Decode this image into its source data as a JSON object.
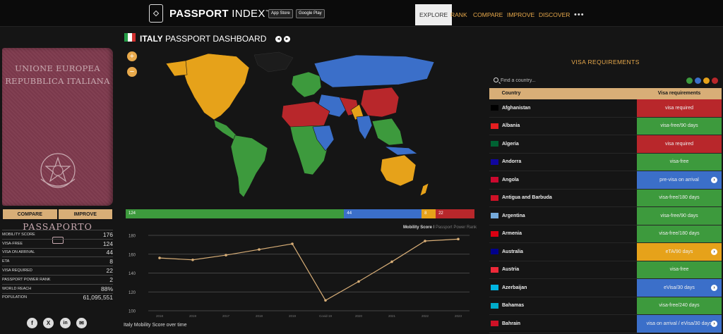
{
  "header": {
    "brand_bold": "PASSPORT",
    "brand_rest": " INDEX",
    "trademark": "™",
    "app_store": "App Store",
    "google_play": "Google Play",
    "nav": [
      "EXPLORE",
      "RANK",
      "COMPARE",
      "IMPROVE",
      "DISCOVER"
    ],
    "more": "•••"
  },
  "passport": {
    "line1": "UNIONE EUROPEA",
    "line2": "REPUBBLICA ITALIANA",
    "bottom": "PASSAPORTO"
  },
  "actions": {
    "compare": "COMPARE",
    "improve": "IMPROVE"
  },
  "stats": [
    {
      "label": "MOBILITY SCORE",
      "value": "176"
    },
    {
      "label": "VISA-FREE",
      "value": "124"
    },
    {
      "label": "VISA ON ARRIVAL",
      "value": "44"
    },
    {
      "label": "ETA",
      "value": "8"
    },
    {
      "label": "VISA REQUIRED",
      "value": "22"
    },
    {
      "label": "PASSPORT POWER RANK",
      "value": "2"
    },
    {
      "label": "WORLD REACH",
      "value": "88%"
    },
    {
      "label": "POPULATION",
      "value": "61,095,551"
    }
  ],
  "social": [
    "f",
    "X",
    "in",
    "✉"
  ],
  "dashboard": {
    "title_bold": "ITALY",
    "title_rest": " PASSPORT DASHBOARD",
    "zoom_in": "+",
    "zoom_out": "−",
    "prev": "◂",
    "next": "▸"
  },
  "breakdown": [
    {
      "label": "124",
      "value": 124,
      "color": "#3d9a3d"
    },
    {
      "label": "44",
      "value": 44,
      "color": "#3b6fc9"
    },
    {
      "label": "8",
      "value": 8,
      "color": "#e6a21a"
    },
    {
      "label": "22",
      "value": 22,
      "color": "#b8272b"
    }
  ],
  "colors": {
    "visa_free": "#3d9a3d",
    "visa_on_arrival": "#3b6fc9",
    "eta": "#e6a21a",
    "visa_required": "#b8272b",
    "accent": "#d8ae77",
    "nav_accent": "#e8a94b"
  },
  "chart_legend": {
    "active": "Mobility Score",
    "separator": " I ",
    "inactive": "Passport Power Rank"
  },
  "chart_data": {
    "type": "line",
    "title": "Italy Mobility Score over time",
    "x": [
      "2018",
      "2019",
      "2017",
      "2018",
      "2019",
      "Covid-19",
      "2020",
      "2021",
      "2022",
      "2023"
    ],
    "values": [
      156,
      154,
      159,
      165,
      171,
      111,
      131,
      152,
      174,
      176
    ],
    "yticks": [
      100,
      120,
      140,
      160,
      180
    ],
    "ylim": [
      100,
      180
    ],
    "series_color": "#d8ae77",
    "grid": true
  },
  "visa": {
    "title": "VISA REQUIREMENTS",
    "search_placeholder": "Find a country...",
    "col_country": "Country",
    "col_req": "Visa requirements",
    "filter_dots": [
      "#3d9a3d",
      "#3b6fc9",
      "#e6a21a",
      "#b8272b"
    ],
    "rows": [
      {
        "country": "Afghanistan",
        "req": "visa required",
        "kind": "visa_required",
        "info": false
      },
      {
        "country": "Albania",
        "req": "visa-free/90 days",
        "kind": "visa_free",
        "info": false
      },
      {
        "country": "Algeria",
        "req": "visa required",
        "kind": "visa_required",
        "info": false
      },
      {
        "country": "Andorra",
        "req": "visa-free",
        "kind": "visa_free",
        "info": false
      },
      {
        "country": "Angola",
        "req": "pre-visa on arrival",
        "kind": "visa_on_arrival",
        "info": true
      },
      {
        "country": "Antigua and Barbuda",
        "req": "visa-free/180 days",
        "kind": "visa_free",
        "info": false
      },
      {
        "country": "Argentina",
        "req": "visa-free/90 days",
        "kind": "visa_free",
        "info": false
      },
      {
        "country": "Armenia",
        "req": "visa-free/180 days",
        "kind": "visa_free",
        "info": false
      },
      {
        "country": "Australia",
        "req": "eTA/90 days",
        "kind": "eta",
        "info": true
      },
      {
        "country": "Austria",
        "req": "visa-free",
        "kind": "visa_free",
        "info": false
      },
      {
        "country": "Azerbaijan",
        "req": "eVisa/30 days",
        "kind": "visa_on_arrival",
        "info": true
      },
      {
        "country": "Bahamas",
        "req": "visa-free/240 days",
        "kind": "visa_free",
        "info": false
      },
      {
        "country": "Bahrain",
        "req": "visa on arrival / eVisa/30 days",
        "kind": "visa_on_arrival",
        "info": true
      }
    ]
  }
}
